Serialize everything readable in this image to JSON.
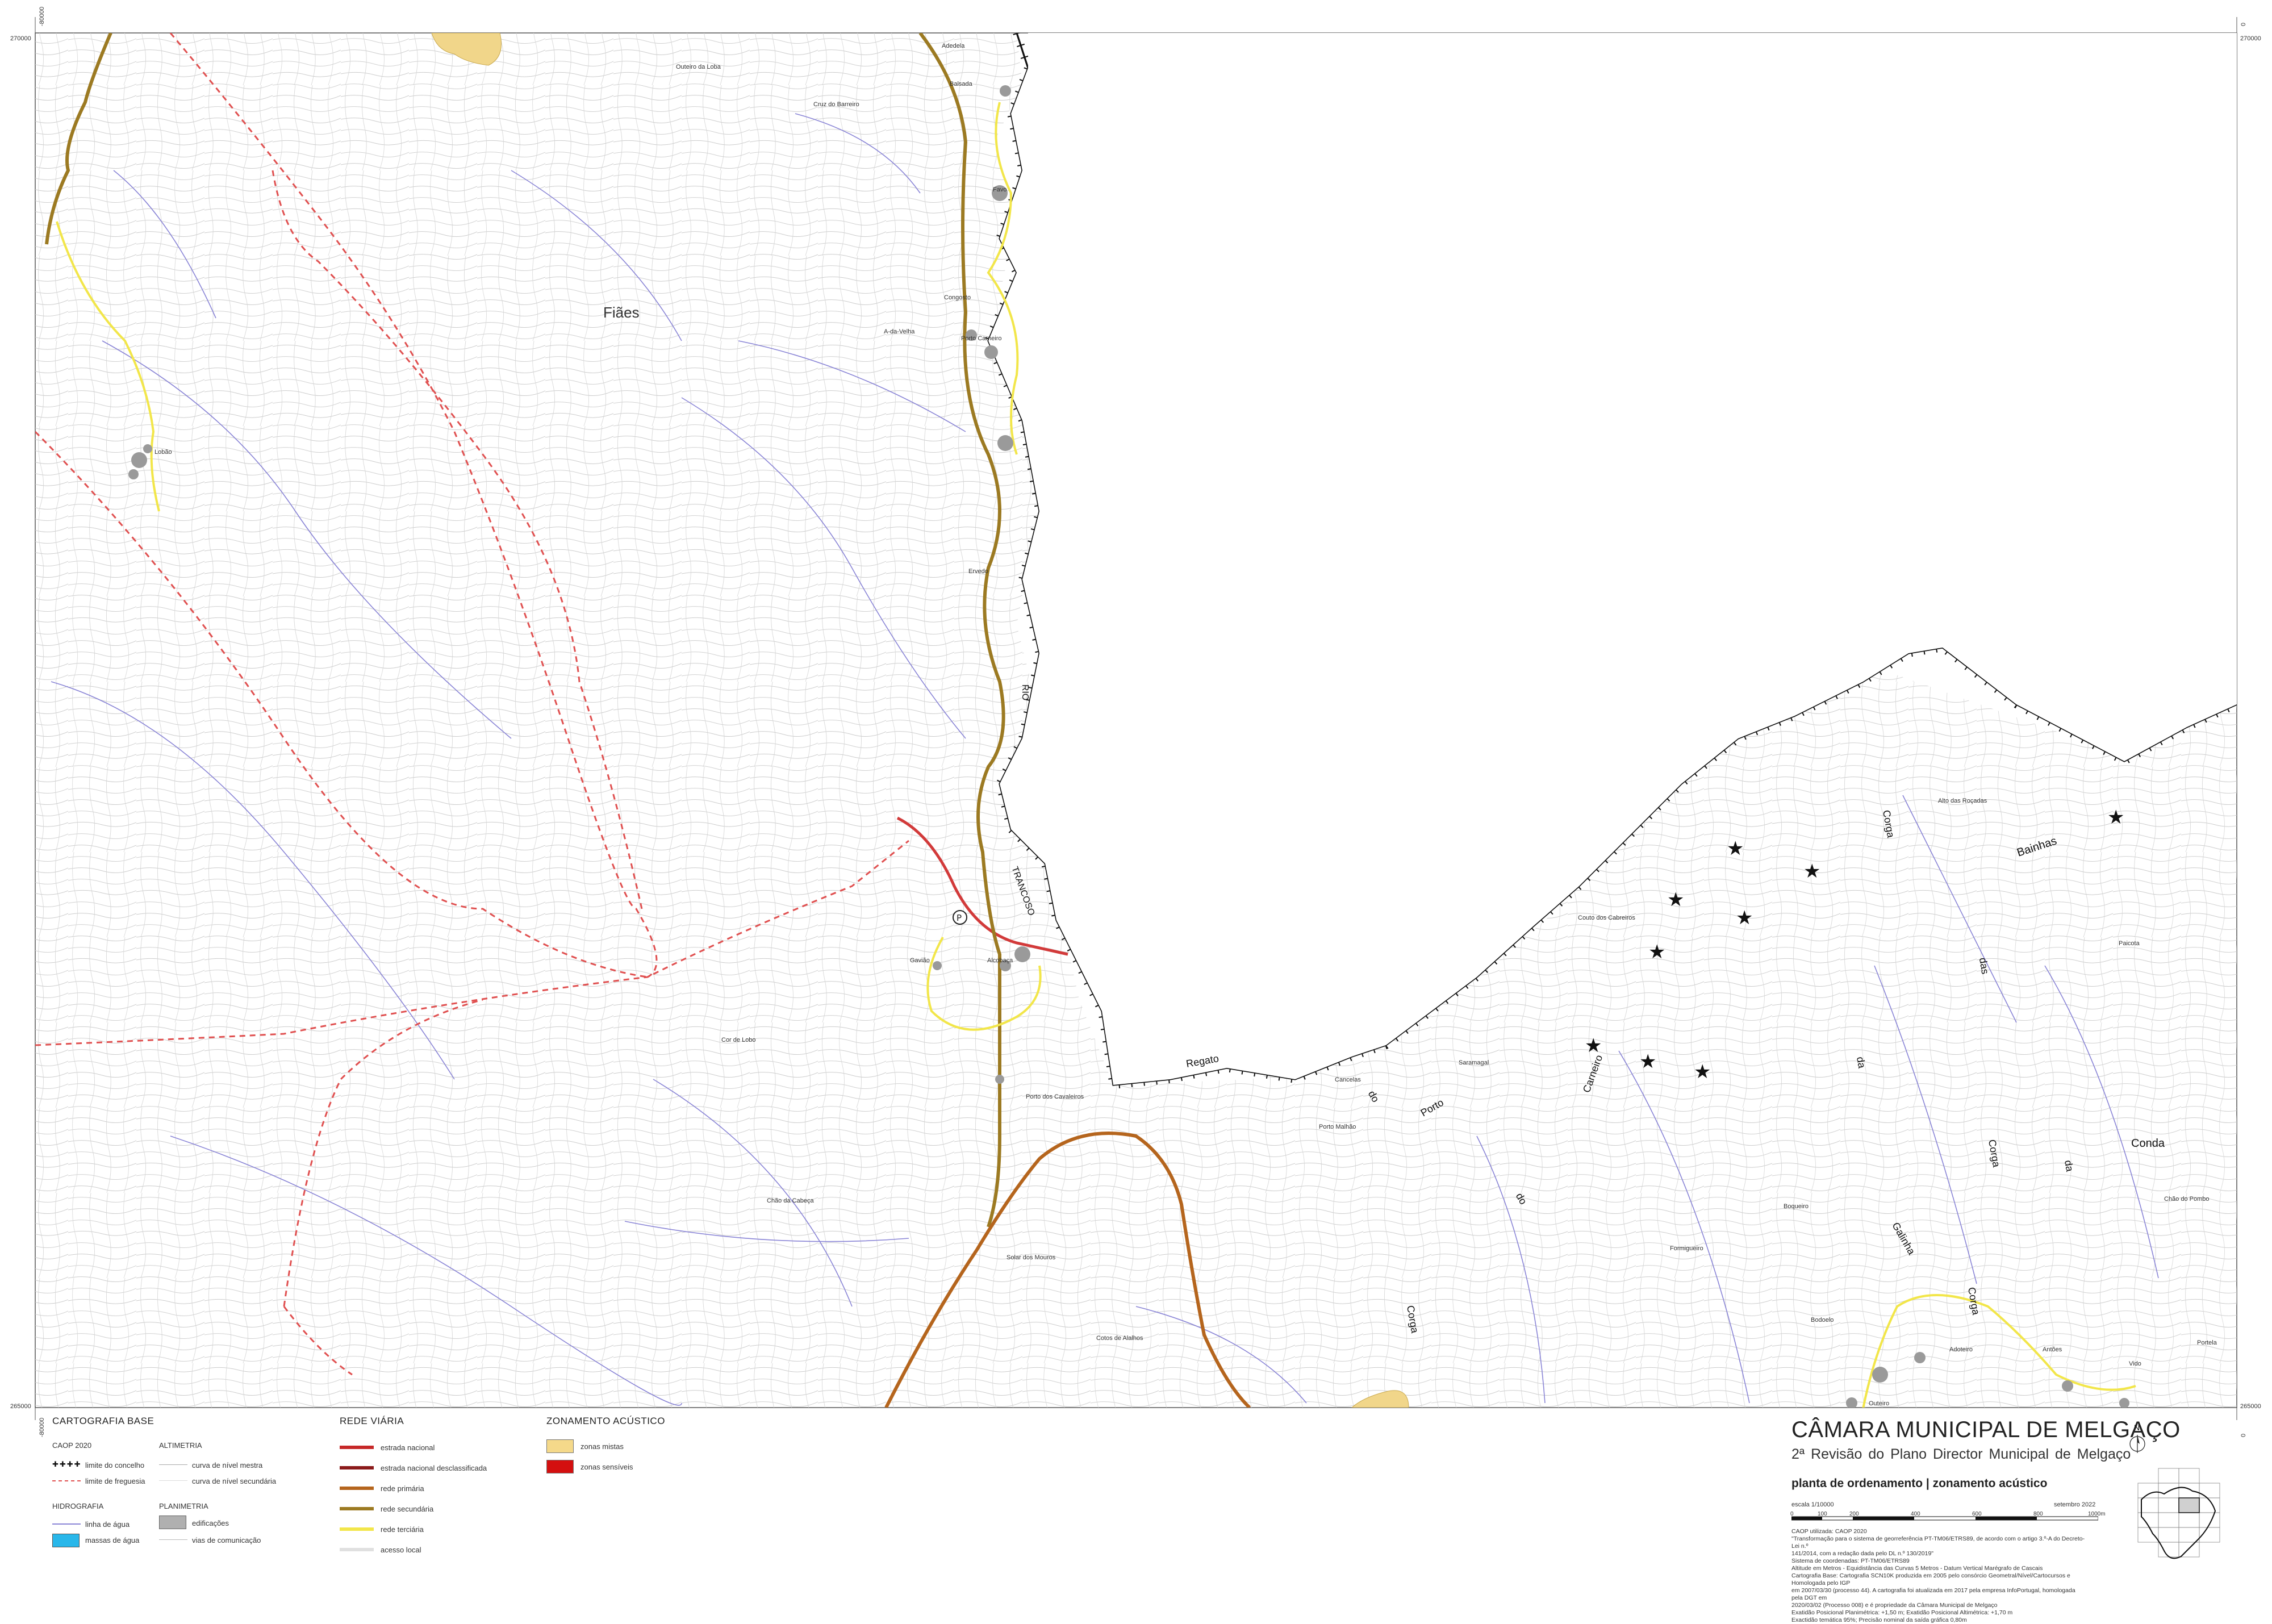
{
  "map": {
    "coords": {
      "top_left_x": "-80000",
      "top_left_y": "270000",
      "top_right_x": "0",
      "top_right_y": "270000",
      "bottom_left_x": "-80000",
      "bottom_left_y": "265000",
      "bottom_right_x": "0",
      "bottom_right_y": "265000"
    },
    "parish_label": "Fiães",
    "places": [
      "Outeiro da Loba",
      "Adedela",
      "Balsada",
      "Cruz do Barreiro",
      "Favo",
      "Congosto",
      "A-da-Velha",
      "Porto Carneiro",
      "Lobão",
      "Fiães",
      "Ervedo",
      "Gavião",
      "Alcobaça",
      "Cor de Lobo",
      "Porto dos Cavaleiros",
      "Chão da Cabeça",
      "Solar dos Mouros",
      "Cotos de Alalhos",
      "Couto dos Cabreiros",
      "Saramagal",
      "Cancelas",
      "Porto Malhão",
      "Alto das Roçadas",
      "Paicota",
      "Boqueiro",
      "Formigueiro",
      "Chão do Pombo",
      "Bodoelo",
      "Adoteiro",
      "Antões",
      "Vido",
      "Portela",
      "Outeiro"
    ],
    "hydro_labels": {
      "rio": "RIO",
      "trancoso": "TRANCOSO",
      "regato": "Regato",
      "do1": "do",
      "porto": "Porto",
      "carneiro": "Carneiro",
      "do2": "do",
      "corga1": "Corga",
      "corga2": "Corga",
      "das": "das",
      "bainhas": "Bainhas",
      "da1": "da",
      "corga3": "Corga",
      "conda": "Conda",
      "da2": "da",
      "galinha": "Galinha",
      "corga4": "Corga"
    }
  },
  "legend": {
    "base": {
      "heading": "CARTOGRAFIA BASE",
      "caop_heading": "CAOP 2020",
      "limite_concelho": "limite do concelho",
      "limite_freguesia": "limite de freguesia",
      "altimetria_heading": "ALTIMETRIA",
      "curva_mestra": "curva de nível mestra",
      "curva_secundaria": "curva de nível secundária",
      "hidrografia_heading": "HIDROGRAFIA",
      "linha_agua": "linha de água",
      "massas_agua": "massas de água",
      "planimetria_heading": "PLANIMETRIA",
      "edificacoes": "edificações",
      "vias": "vias de comunicação"
    },
    "rede_viaria": {
      "heading": "REDE VIÁRIA",
      "items": [
        {
          "label": "estrada nacional",
          "color": "#c62828"
        },
        {
          "label": "estrada nacional desclassificada",
          "color": "#8b1a1a"
        },
        {
          "label": "rede primária",
          "color": "#b5651d"
        },
        {
          "label": "rede secundária",
          "color": "#9c7a22"
        },
        {
          "label": "rede terciária",
          "color": "#f2e64a"
        },
        {
          "label": "acesso local",
          "color": "#e0e0e0"
        }
      ]
    },
    "zonamento": {
      "heading": "ZONAMENTO ACÚSTICO",
      "items": [
        {
          "label": "zonas mistas",
          "color": "#f5d98a"
        },
        {
          "label": "zonas sensíveis",
          "color": "#d40f0f"
        }
      ]
    }
  },
  "title_block": {
    "municipality": "CÂMARA MUNICIPAL DE MELGAÇO",
    "subtitle": "2ª Revisão do Plano Director Municipal de Melgaço",
    "sheet_title": "planta de ordenamento | zonamento acústico",
    "scale_label": "escala 1/10000",
    "date": "setembro 2022",
    "north": "N",
    "scale_ticks": [
      "0",
      "100",
      "200",
      "400",
      "600",
      "800",
      "1000m"
    ],
    "metadata": [
      "CAOP utilizada: CAOP 2020",
      "\"Transformação para o sistema de georreferência PT-TM06/ETRS89, de acordo com o artigo 3.º-A do Decreto-Lei n.º",
      "141/2014, com a redação dada pelo DL n.º 130/2019\"",
      "Sistema de coordenadas: PT-TM06/ETRS89",
      "Altitude em Metros - Equidistância das Curvas 5 Metros - Datum Vertical Marégrafo de Cascais",
      "Cartografia Base: Cartografia SCN10K produzida em 2005 pelo consórcio Geometral/Nível/Cartocursos e Homologada pelo IGP",
      "em 2007/03/30 (processo 44). A cartografia foi atualizada em 2017 pela empresa InfoPortugal, homologada pela DGT em",
      "2020/03/02 (Processo 008) e é propriedade da Câmara Municipal de Melgaço",
      "Exatidão Posicional Planimétrica: +1,50 m; Exatidão Posicional Altimétrica: +1,70 m",
      "Exactidão temática 95%; Precisão nominal da saída gráfica 0,80m"
    ]
  }
}
